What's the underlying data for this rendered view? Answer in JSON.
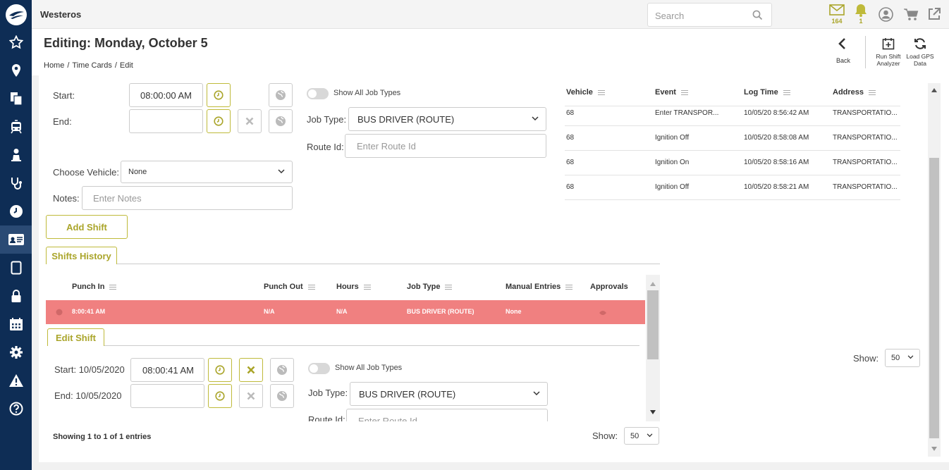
{
  "app": {
    "title": "Westeros"
  },
  "search": {
    "placeholder": "Search"
  },
  "top_icons": {
    "mail_count": "164",
    "bell_count": "1"
  },
  "header": {
    "title": "Editing: Monday, October 5",
    "breadcrumb": [
      "Home",
      "Time Cards",
      "Edit"
    ],
    "actions": {
      "back": "Back",
      "run_shift": "Run Shift Analyzer",
      "load_gps": "Load GPS Data"
    }
  },
  "new_shift": {
    "start_label": "Start:",
    "start_value": "08:00:00 AM",
    "end_label": "End:",
    "end_value": "",
    "show_all_label": "Show All Job Types",
    "job_type_label": "Job Type:",
    "job_type_value": "BUS DRIVER (ROUTE)",
    "route_id_label": "Route Id:",
    "route_id_placeholder": "Enter Route Id",
    "vehicle_label": "Choose Vehicle:",
    "vehicle_value": "None",
    "notes_label": "Notes:",
    "notes_placeholder": "Enter Notes",
    "add_button": "Add Shift"
  },
  "vehicle_log": {
    "columns": [
      "Vehicle",
      "Event",
      "Log Time",
      "Address"
    ],
    "rows": [
      [
        "68",
        "Enter TRANSPOR...",
        "10/05/20 8:56:42 AM",
        "TRANSPORTATIO..."
      ],
      [
        "68",
        "Ignition Off",
        "10/05/20 8:58:08 AM",
        "TRANSPORTATIO..."
      ],
      [
        "68",
        "Ignition On",
        "10/05/20 8:58:16 AM",
        "TRANSPORTATIO..."
      ],
      [
        "68",
        "Ignition Off",
        "10/05/20 8:58:21 AM",
        "TRANSPORTATIO..."
      ]
    ],
    "show_label": "Show:",
    "show_value": "50"
  },
  "history": {
    "tab_label": "Shifts History",
    "columns": [
      "Punch In",
      "Punch Out",
      "Hours",
      "Job Type",
      "Manual Entries",
      "Approvals"
    ],
    "row": {
      "punch_in": "8:00:41 AM",
      "punch_out": "N/A",
      "hours": "N/A",
      "job_type": "BUS DRIVER (ROUTE)",
      "manual": "None"
    },
    "row_color": "#f08080",
    "edit_tab": "Edit Shift",
    "edit": {
      "start_label": "Start:",
      "start_date": "10/05/2020",
      "start_time": "08:00:41 AM",
      "end_label": "End:",
      "end_date": "10/05/2020",
      "end_time": "",
      "show_all_label": "Show All Job Types",
      "job_type_label": "Job Type:",
      "job_type_value": "BUS DRIVER (ROUTE)",
      "route_id_label": "Route Id:",
      "route_id_placeholder": "Enter Route Id"
    },
    "entries_text": "Showing 1 to 1 of 1 entries",
    "show_label": "Show:",
    "show_value": "50"
  },
  "colors": {
    "sidebar": "#0e2d55",
    "accent": "#bfba3a",
    "highlight_row": "#f08080"
  },
  "sidebar_icons": [
    "logo-icon",
    "star-icon",
    "location-pin-icon",
    "documents-icon",
    "bus-icon",
    "person-icon",
    "stethoscope-icon",
    "clock-icon",
    "id-card-icon",
    "tablet-icon",
    "lock-icon",
    "calendar-icon",
    "gear-icon",
    "warning-icon",
    "help-icon"
  ]
}
